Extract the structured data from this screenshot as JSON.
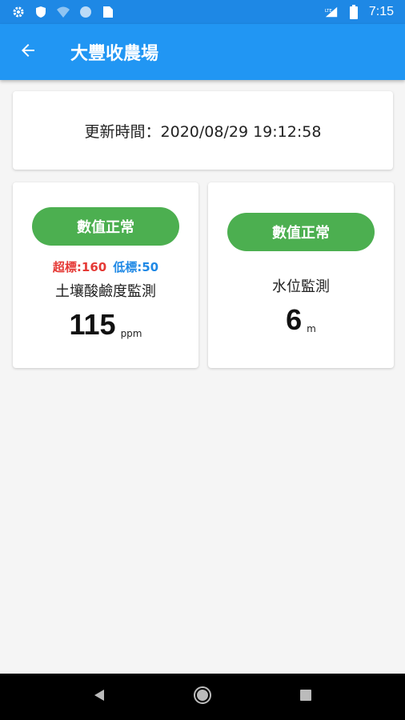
{
  "status_bar": {
    "time": "7:15",
    "network": "LTE",
    "left_icons": [
      "gear-icon",
      "shield-icon",
      "wifi-icon",
      "circle-icon",
      "sim-card-icon"
    ],
    "right_icons": [
      "signal-icon",
      "battery-icon"
    ]
  },
  "app_bar": {
    "title": "大豐收農場",
    "back_icon": "arrow-left-icon"
  },
  "update": {
    "label": "更新時間：2020/08/29 19:12:58"
  },
  "sensors": [
    {
      "status_label": "數值正常",
      "status_color": "#4caf50",
      "high_threshold": "超標:160",
      "low_threshold": "低標:50",
      "name": "土壤酸鹼度監測",
      "value": "115",
      "unit": "ppm"
    },
    {
      "status_label": "數值正常",
      "status_color": "#4caf50",
      "name": "水位監測",
      "value": "6",
      "unit": "m"
    }
  ],
  "colors": {
    "app_bar": "#2196f3",
    "high": "#e53935",
    "low": "#1e88e5"
  },
  "nav_bar": {
    "icons": [
      "back-triangle-icon",
      "home-circle-icon",
      "recents-square-icon"
    ]
  }
}
